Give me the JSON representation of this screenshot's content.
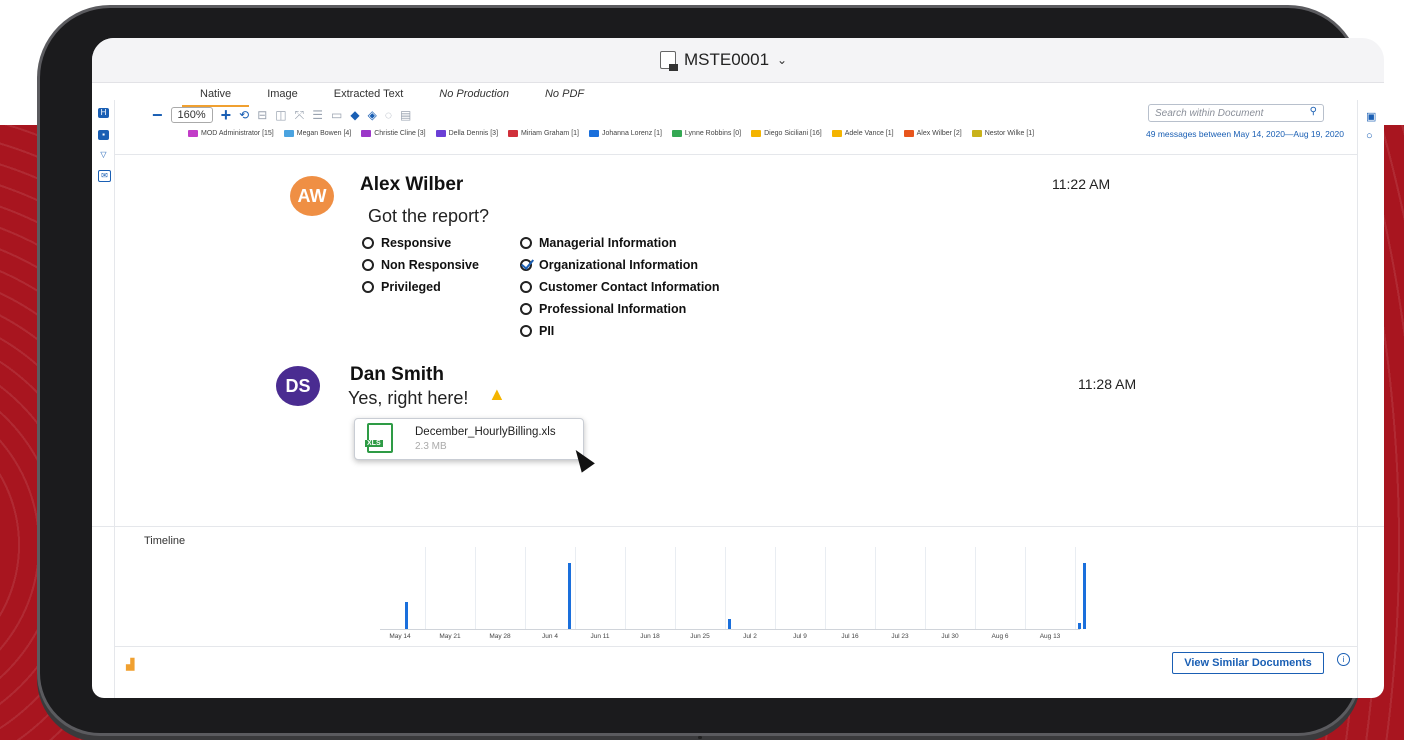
{
  "window": {
    "title": "MSTE0001"
  },
  "tabs": [
    {
      "label": "Native"
    },
    {
      "label": "Image"
    },
    {
      "label": "Extracted Text"
    },
    {
      "label": "No Production"
    },
    {
      "label": "No PDF"
    }
  ],
  "toolbar": {
    "zoom": "160%"
  },
  "search": {
    "placeholder": "Search within Document"
  },
  "participants": [
    {
      "label": "MOD Administrator [15]",
      "color": "#c23cc8"
    },
    {
      "label": "Megan Bowen [4]",
      "color": "#4aa3e0"
    },
    {
      "label": "Christie Cline [3]",
      "color": "#9b37c8"
    },
    {
      "label": "Della Dennis [3]",
      "color": "#6a3fd6"
    },
    {
      "label": "Miriam Graham [1]",
      "color": "#d0303a"
    },
    {
      "label": "Johanna Lorenz [1]",
      "color": "#1a6fdc"
    },
    {
      "label": "Lynne Robbins [0]",
      "color": "#34a853"
    },
    {
      "label": "Diego Siciliani [16]",
      "color": "#f4b400"
    },
    {
      "label": "Adele Vance [1]",
      "color": "#f4b400"
    },
    {
      "label": "Alex Wilber [2]",
      "color": "#e8551c"
    },
    {
      "label": "Nestor Wilke [1]",
      "color": "#c9b21a"
    }
  ],
  "message_count": "49 messages between May 14, 2020—Aug 19, 2020",
  "messages": [
    {
      "initials": "AW",
      "avatar_color": "#ef8f44",
      "sender": "Alex Wilber",
      "time": "11:22 AM",
      "text": "Got the report?"
    },
    {
      "initials": "DS",
      "avatar_color": "#4a2c91",
      "sender": "Dan Smith",
      "time": "11:28 AM",
      "text": "Yes, right here!"
    }
  ],
  "coding_options": {
    "left": [
      "Responsive",
      "Non Responsive",
      "Privileged"
    ],
    "right": [
      "Managerial Information",
      "Organizational Information",
      "Customer Contact Information",
      "Professional Information",
      "PII"
    ],
    "checked": "Organizational Information"
  },
  "attachment": {
    "name": "December_HourlyBilling.xls",
    "size": "2.3 MB",
    "type_label": "XLS"
  },
  "timeline": {
    "label": "Timeline",
    "ticks": [
      "May 14",
      "May 21",
      "May 28",
      "Jun 4",
      "Jun 11",
      "Jun 18",
      "Jun 25",
      "Jul 2",
      "Jul 9",
      "Jul 16",
      "Jul 23",
      "Jul 30",
      "Aug 6",
      "Aug 13"
    ],
    "bars": [
      {
        "week_index": 0.1,
        "value": 17
      },
      {
        "week_index": 3.35,
        "value": 41
      },
      {
        "week_index": 6.55,
        "value": 6
      },
      {
        "week_index": 13.55,
        "value": 4
      },
      {
        "week_index": 13.65,
        "value": 41
      }
    ],
    "max_value": 45,
    "bar_color": "#1a6fdc"
  },
  "buttons": {
    "view_similar": "View Similar Documents"
  }
}
